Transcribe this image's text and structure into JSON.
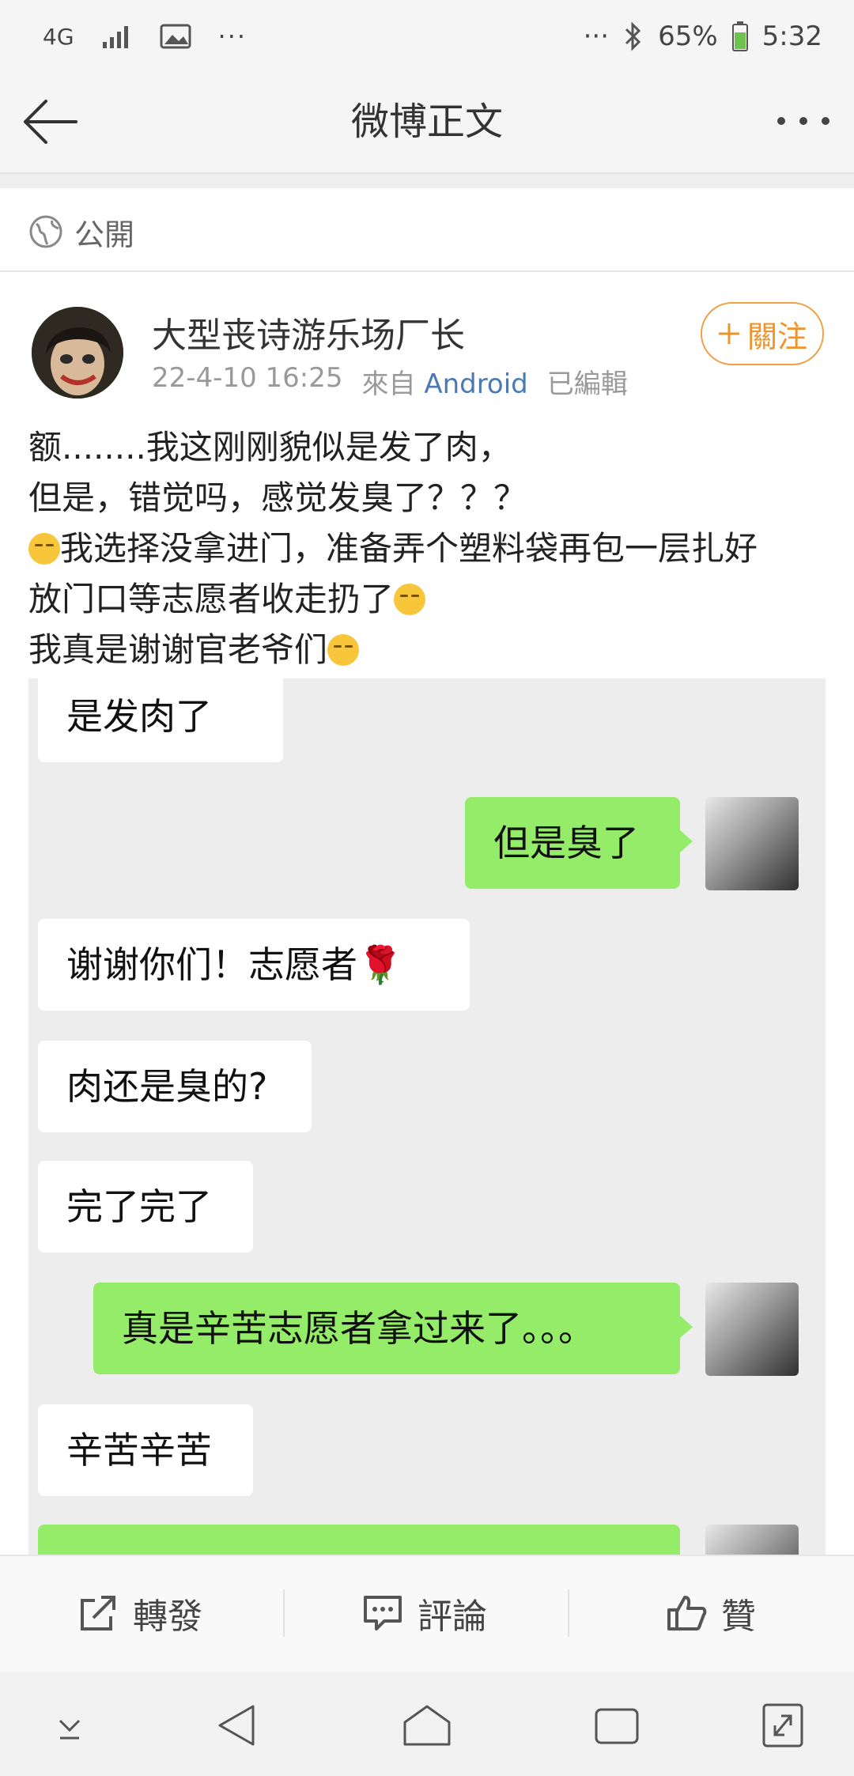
{
  "status_bar": {
    "network": "4G",
    "battery": "65%",
    "time": "5:32"
  },
  "nav": {
    "title": "微博正文"
  },
  "visibility": {
    "label": "公開"
  },
  "post": {
    "author": "大型丧诗游乐场厂长",
    "timestamp": "22-4-10 16:25",
    "source_prefix": "來自",
    "source": "Android",
    "edited": "已編輯",
    "follow_label": "關注",
    "lines": [
      "额........我这刚刚貌似是发了肉，",
      "但是，错觉吗，感觉发臭了？？？",
      "我选择没拿进门，准备弄个塑料袋再包一层扎好",
      "放门口等志愿者收走扔了",
      "我真是谢谢官老爷们"
    ]
  },
  "chat": {
    "messages": [
      {
        "side": "left",
        "text": "是发肉了"
      },
      {
        "side": "right",
        "text": "但是臭了"
      },
      {
        "side": "left",
        "text": "谢谢你们！志愿者🌹"
      },
      {
        "side": "left",
        "text": "肉还是臭的?"
      },
      {
        "side": "left",
        "text": "完了完了"
      },
      {
        "side": "right",
        "text": "真是辛苦志愿者拿过来了。。。"
      },
      {
        "side": "left",
        "text": "辛苦辛苦"
      }
    ]
  },
  "actions": {
    "repost": "轉發",
    "comment": "評論",
    "like": "贊"
  },
  "colors": {
    "follow_orange": "#f0932b",
    "source_blue": "#4a79b4",
    "bubble_green": "#95ec69"
  },
  "icons": [
    "back-arrow-icon",
    "more-icon",
    "globe-icon",
    "plus-icon",
    "repost-icon",
    "comment-icon",
    "thumbs-up-icon"
  ]
}
